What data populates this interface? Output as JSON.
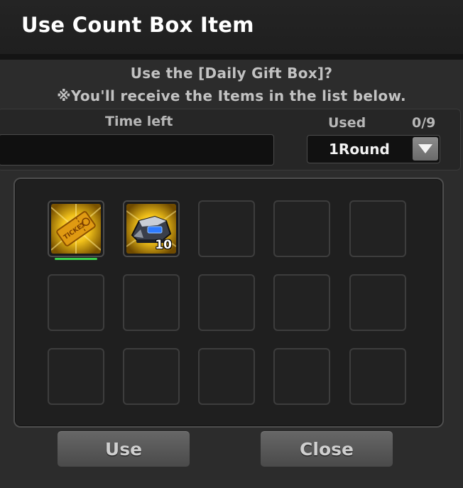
{
  "dialog": {
    "title": "Use Count Box Item",
    "message_line1": "Use the [Daily Gift Box]?",
    "message_line2": "※You'll receive the Items in the list below."
  },
  "info": {
    "time_left_label": "Time left",
    "time_left_value": "",
    "used_label": "Used",
    "used_count": "0/9",
    "round_value": "1Round"
  },
  "items": [
    {
      "name": "ticket",
      "quantity": ""
    },
    {
      "name": "speed-booster",
      "quantity": "10"
    }
  ],
  "empty_slots": 13,
  "buttons": {
    "use_label": "Use",
    "close_label": "Close"
  },
  "colors": {
    "item_highlight": "#f2c21a",
    "selection_bar": "#3bd04c"
  }
}
